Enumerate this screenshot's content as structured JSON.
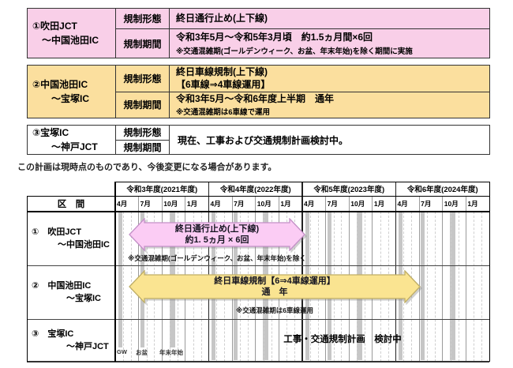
{
  "colors": {
    "block1_bg": "#f9cfe8",
    "block2_bg": "#fbdf9e",
    "pink_arrow_fill": "#fbccf4",
    "pink_arrow_stroke": "#c490c8",
    "yellow_arrow_fill": "#fae491",
    "yellow_arrow_stroke": "#bfae66",
    "congestion_bar": "#c6c6c6"
  },
  "summary": {
    "blocks": [
      {
        "section": "①吹田JCT\n　～中国池田IC",
        "rows": [
          {
            "label": "規制形態",
            "text": "終日通行止め(上下線)",
            "note": ""
          },
          {
            "label": "規制期間",
            "text": "令和3年5月～令和5年3月頃　約1.5ヵ月間×6回",
            "note": "※交通混雑期(ゴールデンウィーク、お盆、年末年始)を除く期間に実施"
          }
        ]
      },
      {
        "section": "②中国池田IC\n　　～宝塚IC",
        "rows": [
          {
            "label": "規制形態",
            "text": "終日車線規制(上下線)\n【6車線⇒4車線運用】",
            "note": ""
          },
          {
            "label": "規制期間",
            "text": "令和3年5月～令和6年度上半期　通年",
            "note": "※交通混雑期は6車線で運用"
          }
        ]
      },
      {
        "section": "③宝塚IC\n　　～神戸JCT",
        "row_labels": [
          "規制形態",
          "規制期間"
        ],
        "merged": "現在、工事および交通規制計画検討中。"
      }
    ]
  },
  "note": "この計画は現時点のものであり、今後変更になる場合があります。",
  "gantt": {
    "corner": "区　間",
    "years": [
      "令和3年度(2021年度)",
      "令和4年度(2022年度)",
      "令和5年度(2023年度)",
      "令和6年度(2024年度)"
    ],
    "months": [
      "4月",
      "7月",
      "10月",
      "1月"
    ],
    "rows": [
      {
        "name": "①　吹田JCT\n　　　～中国池田IC"
      },
      {
        "name": "②　中国池田IC\n　　　　～宝塚IC"
      },
      {
        "name": "③　宝塚IC\n　　　　～神戸JCT"
      }
    ],
    "pink_arrow": {
      "line1": "終日通行止め(上下線)",
      "line2": "約1. 5ヵ月 × 6回",
      "note": "※交通混雑期(ゴールデンウィーク、お盆、年末年始)を除く"
    },
    "yellow_arrow": {
      "line1": "終日車線規制【6⇒4車線運用】",
      "line2": "通　年",
      "note": "※交通混雑期は6車線運用"
    },
    "row3_text": "工事・交通規制計画　検討中",
    "legend": [
      "GW",
      "お盆",
      "年末年始"
    ]
  }
}
